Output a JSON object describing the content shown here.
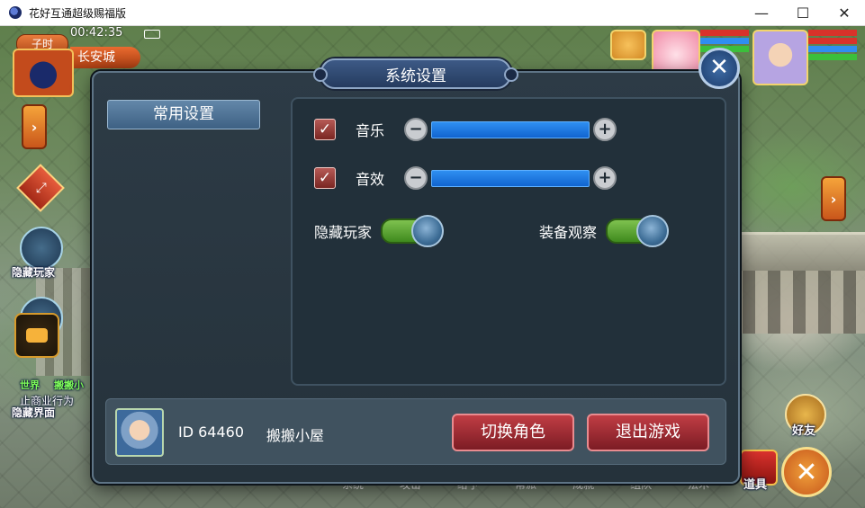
{
  "window": {
    "title": "花好互通超级赐福版",
    "controls": [
      "—",
      "☐",
      "✕"
    ]
  },
  "hud": {
    "time_of_day": "子时",
    "clock": "00:42:35",
    "city": "长安城",
    "left_buttons": [
      "隐藏玩家",
      "隐藏界面"
    ],
    "chat_tag": "世界",
    "chat_text": "止商业行为",
    "chat_snippet": "搬搬小",
    "bottom_menu": [
      "系统",
      "攻击",
      "给予",
      "帮派",
      "成就",
      "组队",
      "法术"
    ],
    "friend_label": "好友",
    "bag_label": "道具"
  },
  "dialog": {
    "title": "系统设置",
    "close_symbol": "✕",
    "tabs": [
      {
        "label": "常用设置",
        "active": true
      }
    ],
    "settings": {
      "music": {
        "label": "音乐",
        "checked": true,
        "minus": "−",
        "plus": "+"
      },
      "sfx": {
        "label": "音效",
        "checked": true,
        "minus": "−",
        "plus": "+"
      },
      "hide_players": {
        "label": "隐藏玩家",
        "on": true
      },
      "equip_view": {
        "label": "装备观察",
        "on": true
      }
    },
    "footer": {
      "player_id": "ID 64460",
      "player_name": "搬搬小屋",
      "switch_role": "切换角色",
      "exit_game": "退出游戏"
    }
  },
  "colors": {
    "accent_blue": "#1a73e8",
    "toggle_green": "#5faa33",
    "button_red": "#a52a33"
  }
}
